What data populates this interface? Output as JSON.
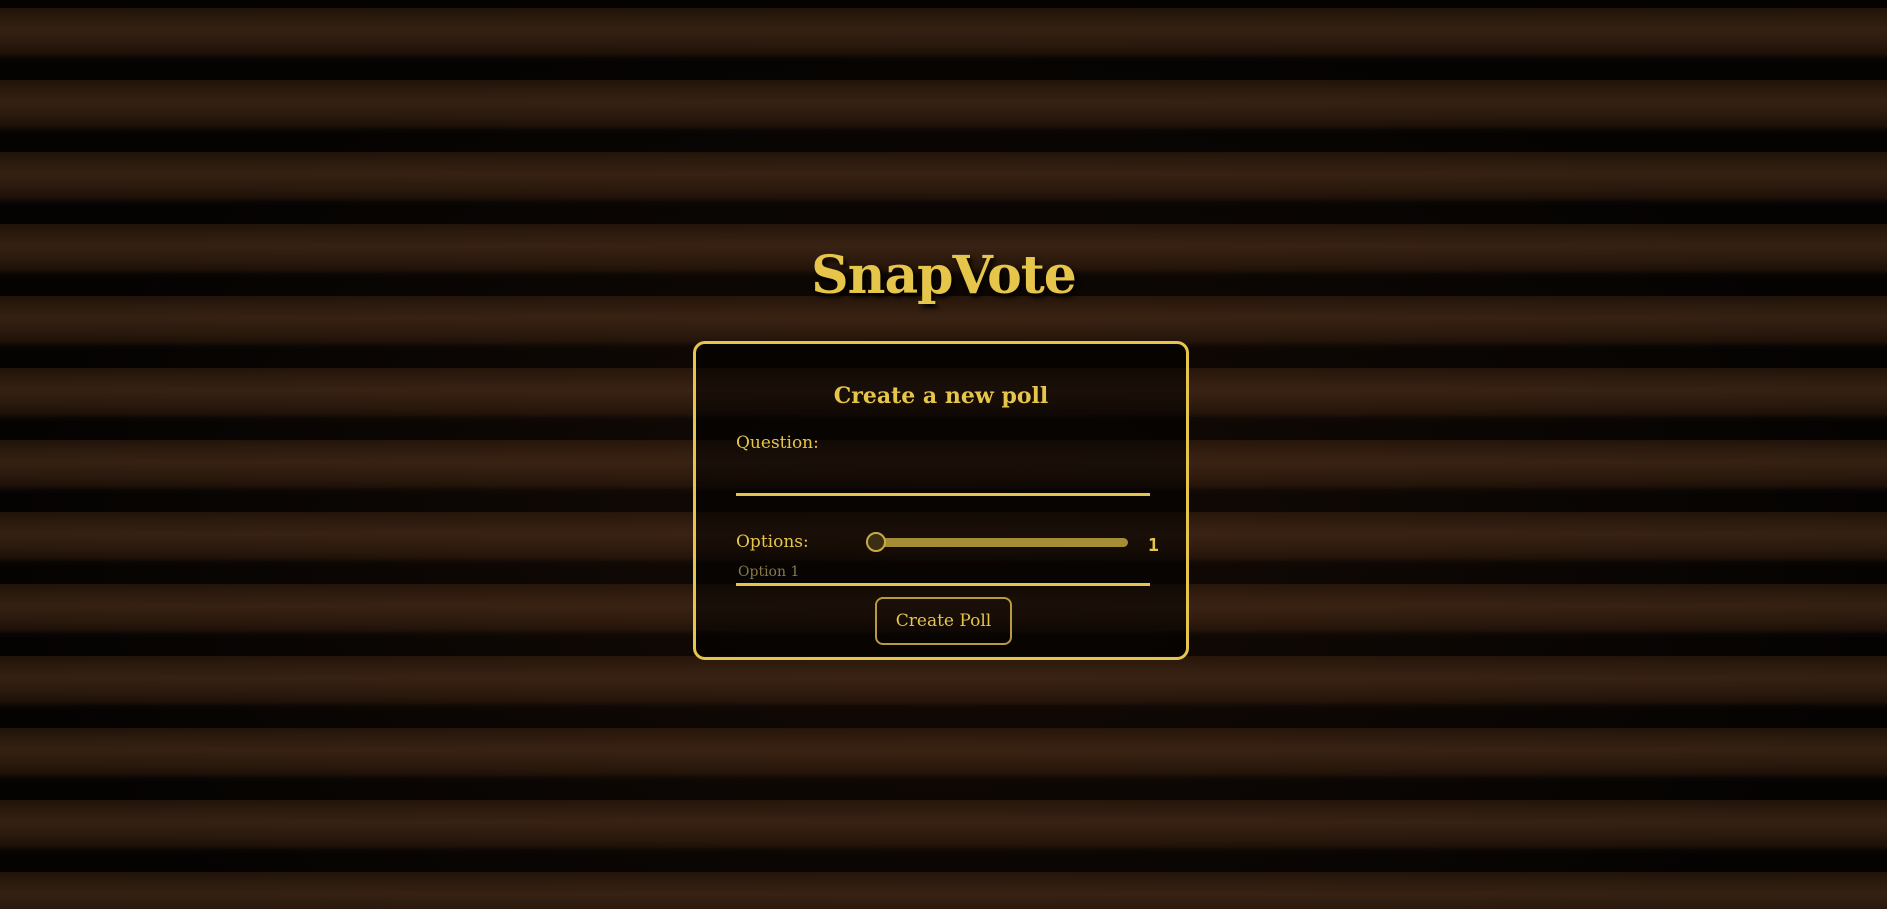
{
  "app": {
    "title": "SnapVote"
  },
  "form": {
    "heading": "Create a new poll",
    "question_label": "Question:",
    "question_value": "",
    "options_label": "Options:",
    "options_slider": {
      "value": 1,
      "display": "1"
    },
    "option_inputs": [
      {
        "placeholder": "Option 1",
        "value": ""
      }
    ],
    "submit_label": "Create Poll"
  },
  "colors": {
    "accent": "#e5c54a",
    "slider_track": "#a58d36",
    "background": "#2b1a0e"
  }
}
